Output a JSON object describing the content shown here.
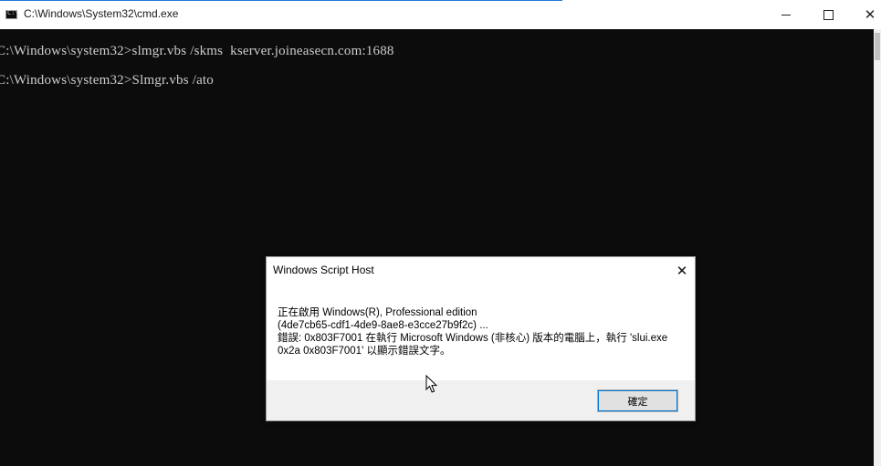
{
  "window": {
    "title": "C:\\Windows\\System32\\cmd.exe",
    "app_icon_text": "C:\\",
    "controls": {
      "minimize": "",
      "maximize": "",
      "close": "✕"
    }
  },
  "console": {
    "lines": [
      "C:\\Windows\\system32>slmgr.vbs /skms  kserver.joineasecn.com:1688",
      "C:\\Windows\\system32>Slmgr.vbs /ato"
    ]
  },
  "dialog": {
    "title": "Windows Script Host",
    "close_glyph": "✕",
    "message_lines": [
      "正在啟用 Windows(R), Professional edition",
      "(4de7cb65-cdf1-4de9-8ae8-e3cce27b9f2c) ...",
      "錯誤: 0x803F7001 在執行 Microsoft Windows (非核心) 版本的電腦上，執行 'slui.exe",
      "0x2a 0x803F7001' 以顯示錯誤文字。"
    ],
    "ok_label": "確定"
  }
}
